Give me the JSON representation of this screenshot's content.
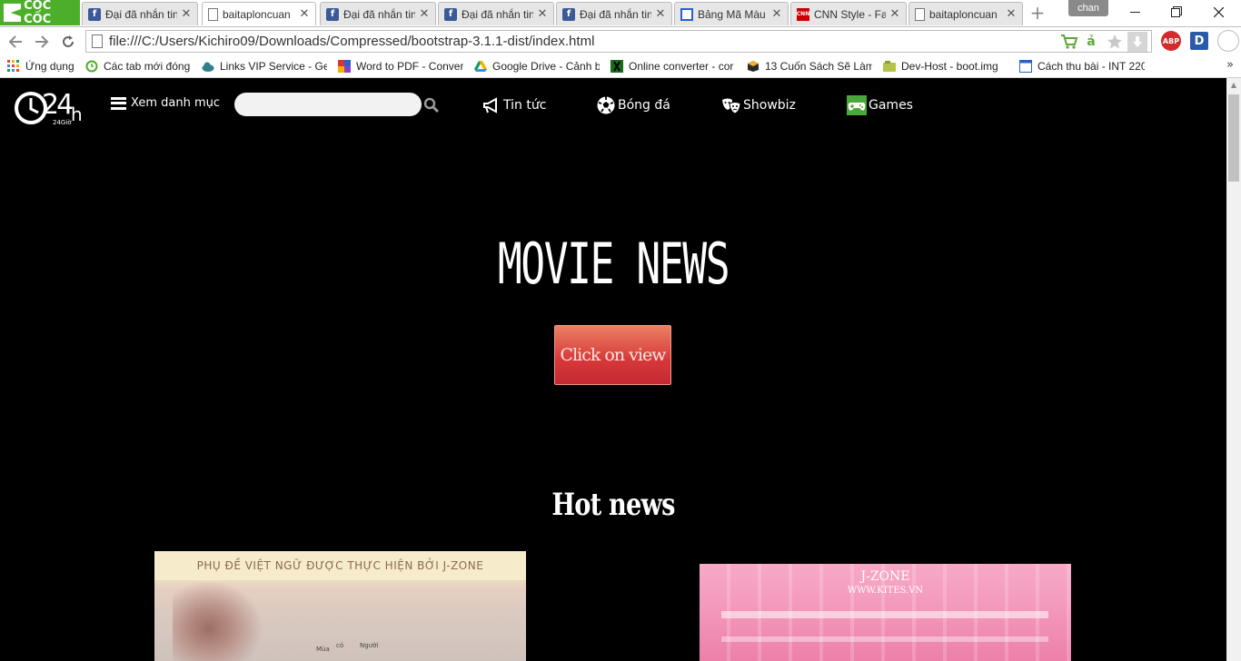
{
  "browser": {
    "brand": "CỐC CỐC",
    "profile_name": "chan",
    "tabs": [
      {
        "title": "Đại đã nhắn tin",
        "favicon": "facebook-icon",
        "active": false
      },
      {
        "title": "baitaploncuan",
        "favicon": "page-icon",
        "active": true
      },
      {
        "title": "Đại đã nhắn tin",
        "favicon": "facebook-icon",
        "active": false
      },
      {
        "title": "Đại đã nhắn tin",
        "favicon": "facebook-icon",
        "active": false
      },
      {
        "title": "Đại đã nhắn tin",
        "favicon": "facebook-icon",
        "active": false
      },
      {
        "title": "Bảng Mã Màu",
        "favicon": "color-table-icon",
        "active": false
      },
      {
        "title": "CNN Style - Fa",
        "favicon": "cnn-icon",
        "active": false
      },
      {
        "title": "baitaploncuan",
        "favicon": "page-icon",
        "active": false
      }
    ],
    "cnn_label": "CNN",
    "address": "file:///C:/Users/Kichiro09/Downloads/Compressed/bootstrap-3.1.1-dist/index.html",
    "ext_abp": "ABP",
    "ext_d": "D",
    "bookmarks": [
      {
        "label": "Ứng dụng",
        "icon": "apps-grid-icon"
      },
      {
        "label": "Các tab mới đóng",
        "icon": "recent-tabs-icon"
      },
      {
        "label": "Links VIP Service - Get",
        "icon": "cloud-icon"
      },
      {
        "label": "Word to PDF - Conver",
        "icon": "word-pdf-icon"
      },
      {
        "label": "Google Drive - Cảnh b",
        "icon": "google-drive-icon"
      },
      {
        "label": "Online converter - cor",
        "icon": "converter-icon"
      },
      {
        "label": "13 Cuốn Sách Sẽ Làm",
        "icon": "box-icon"
      },
      {
        "label": "Dev-Host - boot.img",
        "icon": "devhost-icon"
      },
      {
        "label": "Cách thu bài - INT 220",
        "icon": "page-icon"
      }
    ]
  },
  "site": {
    "logo_text": "24",
    "logo_sub": "24Giờ",
    "menu_label": "Xem danh mục",
    "search_value": "",
    "nav": [
      {
        "label": "Tin tức",
        "icon": "megaphone-icon"
      },
      {
        "label": "Bóng đá",
        "icon": "soccer-ball-icon"
      },
      {
        "label": "Showbiz",
        "icon": "theater-masks-icon"
      },
      {
        "label": "Games",
        "icon": "gamepad-icon"
      }
    ],
    "hero_title": "MOVIE NEWS",
    "hero_button": "Click on view",
    "section_title": "Hot news",
    "posters": [
      {
        "caption": "PHỤ ĐỀ VIỆT NGỮ ĐƯỢC THỰC HIỆN BỞI J-ZONE",
        "small_1": "Mùa",
        "small_2": "có",
        "small_3": "Người"
      },
      {
        "brand": "J-ZONE",
        "site": "WWW.KITES.VN"
      }
    ]
  }
}
